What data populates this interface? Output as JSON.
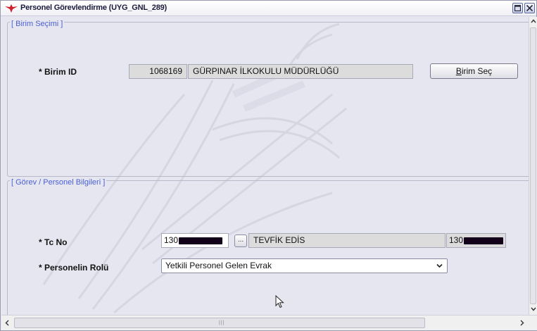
{
  "window": {
    "title": "Personel Görevlendirme (UYG_GNL_289)"
  },
  "birim_section": {
    "legend": "[ Birim Seçimi ]",
    "birim_id_label": "* Birim ID",
    "birim_id_value": "1068169",
    "birim_name_value": "GÜRPINAR İLKOKULU MÜDÜRLÜĞÜ",
    "birim_sec_button_first": "B",
    "birim_sec_button_rest": "irim Seç"
  },
  "gorev_section": {
    "legend": "[ Görev / Personel Bilgileri ]",
    "tc_label": "* Tc No",
    "tc_value_prefix": "130",
    "lookup_button": "...",
    "personel_name": "TEVFİK EDİS",
    "tc_display_prefix": "130",
    "rol_label": "* Personelin Rolü",
    "rol_selected": "Yetkili Personel Gelen Evrak"
  },
  "colors": {
    "legend": "#4a5fd0",
    "background": "#e6e6f1",
    "readonly_field": "#dcdcdc"
  },
  "icons": [
    "app-logo-icon",
    "maximize-icon",
    "close-icon",
    "chevron-down-icon",
    "scroll-up-icon",
    "scroll-down-icon",
    "scroll-left-icon",
    "scroll-right-icon",
    "mouse-cursor-icon"
  ]
}
